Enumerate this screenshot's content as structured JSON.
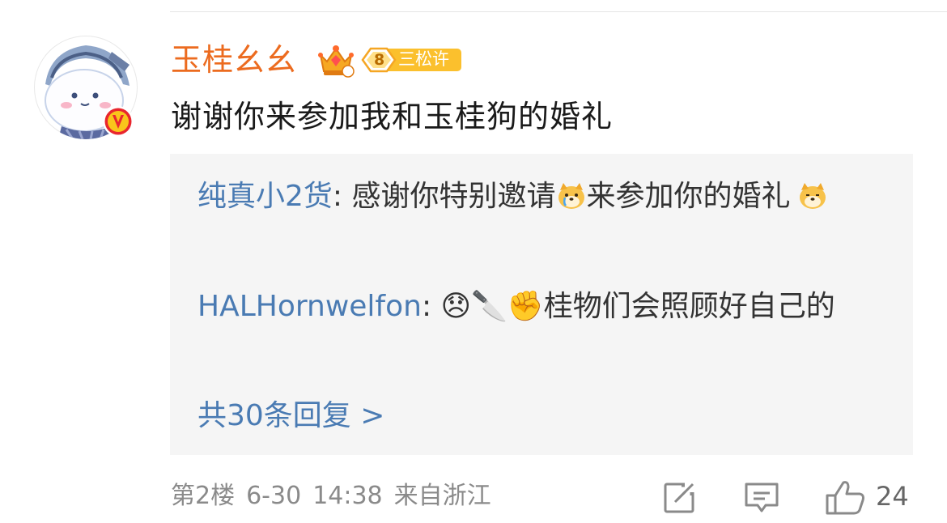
{
  "comment": {
    "username": "玉桂幺幺",
    "level_badge": "三松许",
    "level_number": "8",
    "text": "谢谢你来参加我和玉桂狗的婚礼"
  },
  "replies": [
    {
      "user": "纯真小2货",
      "separator": ": ",
      "text_before": "感谢你特别邀请",
      "text_after": "来参加你的婚礼"
    },
    {
      "user": "HALHornwelfon",
      "separator": ": ",
      "emoji_1": "😞",
      "emoji_2": "🔪",
      "emoji_3": "✊",
      "text": "桂物们会照顾好自己的"
    }
  ],
  "more_replies": "共30条回复 >",
  "meta": {
    "floor": "第2楼",
    "date": "6-30",
    "time": "14:38",
    "location": "来自浙江"
  },
  "actions": {
    "like_count": "24"
  },
  "icons": [
    "avatar",
    "verified-v-icon",
    "crown-icon",
    "level-badge-icon",
    "doge-emoji-icon",
    "share-icon",
    "comment-icon",
    "like-icon"
  ],
  "colors": {
    "username": "#ec6b1f",
    "link": "#4a7bb3",
    "reply_background": "#f5f5f5",
    "meta": "#8a8a8a"
  }
}
